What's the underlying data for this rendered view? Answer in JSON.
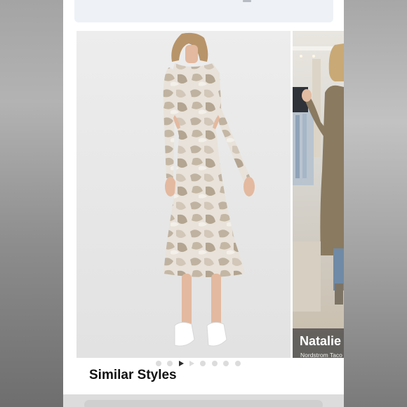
{
  "carousel": {
    "total_slides": 8,
    "active_slide": 3
  },
  "stylist_card": {
    "name": "Natalie",
    "store": "Nordstrom Taco"
  },
  "similar_styles": {
    "title": "Similar Styles"
  },
  "colors": {
    "dress_base": "#e6e0d8",
    "dress_pattern": "#b8aa98",
    "page_background": "#ffffff",
    "dot_inactive": "#dcdcdc",
    "dot_active": "#2d2d2d"
  }
}
